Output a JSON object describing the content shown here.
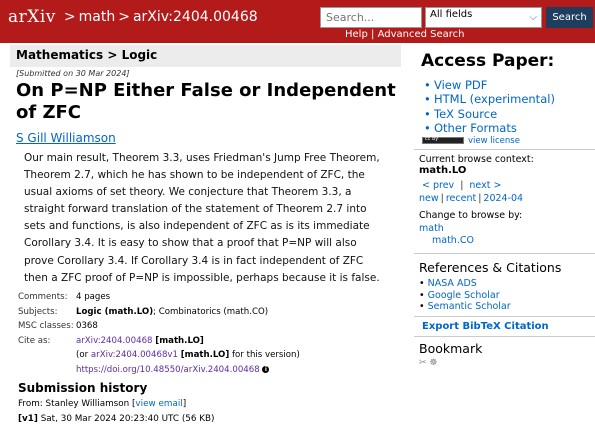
{
  "header": {
    "logo": "arXiv",
    "breadcrumb": [
      {
        "label": "math"
      },
      {
        "label": "arXiv:2404.00468"
      }
    ],
    "search_placeholder": "Search...",
    "field_select": "All fields",
    "search_button": "Search",
    "help_link": "Help",
    "advanced_link": "Advanced Search"
  },
  "paper": {
    "subject": "Mathematics > Logic",
    "submitted": "[Submitted on 30 Mar 2024]",
    "title": "On P=NP Either False or Independent of ZFC",
    "author": "S Gill Williamson",
    "abstract": "Our main result, Theorem 3.3, uses Friedman's Jump Free Theorem, Theorem 2.7, which he has shown to be independent of ZFC, the usual axioms of set theory. We conjecture that Theorem 3.3, a straight forward translation of the statement of Theorem 2.7 into sets and functions, is also independent of ZFC as is its immediate Corollary 3.4. It is easy to show that a proof that P=NP will also prove Corollary 3.4. If Corollary 3.4 is in fact independent of ZFC then a ZFC proof of P=NP is impossible, perhaps because it is false."
  },
  "meta": {
    "comments_label": "Comments:",
    "comments": "4 pages",
    "subjects_label": "Subjects:",
    "subjects_primary": "Logic (math.LO)",
    "subjects_rest": "; Combinatorics (math.CO)",
    "msc_label": "MSC classes:",
    "msc": "0368",
    "cite_label": "Cite as:",
    "cite_id": "arXiv:2404.00468",
    "cite_cat": "[math.LO]",
    "cite_v1_prefix": "(or ",
    "cite_v1": "arXiv:2404.00468v1",
    "cite_v1_cat": "[math.LO]",
    "cite_v1_suffix": " for this version)",
    "doi": "https://doi.org/10.48550/arXiv.2404.00468"
  },
  "history": {
    "title": "Submission history",
    "from_prefix": "From: Stanley Williamson [",
    "view_email": "view email",
    "from_suffix": "]",
    "v1_label": "[v1]",
    "v1_text": " Sat, 30 Mar 2024 20:23:40 UTC (56 KB)"
  },
  "access": {
    "title": "Access Paper:",
    "items": [
      "View PDF",
      "HTML (experimental)",
      "TeX Source",
      "Other Formats"
    ],
    "license_link": "view license"
  },
  "context": {
    "label": "Current browse context:",
    "value": "math.LO",
    "prev": "< prev",
    "next": "next >",
    "new": "new",
    "recent": "recent",
    "month": "2024-04",
    "change_label": "Change to browse by:",
    "change_math": "math",
    "change_mathco": "math.CO"
  },
  "refs": {
    "title": "References & Citations",
    "items": [
      "NASA ADS",
      "Google Scholar",
      "Semantic Scholar"
    ],
    "bibtex": "Export BibTeX Citation"
  },
  "bookmark": {
    "title": "Bookmark"
  }
}
